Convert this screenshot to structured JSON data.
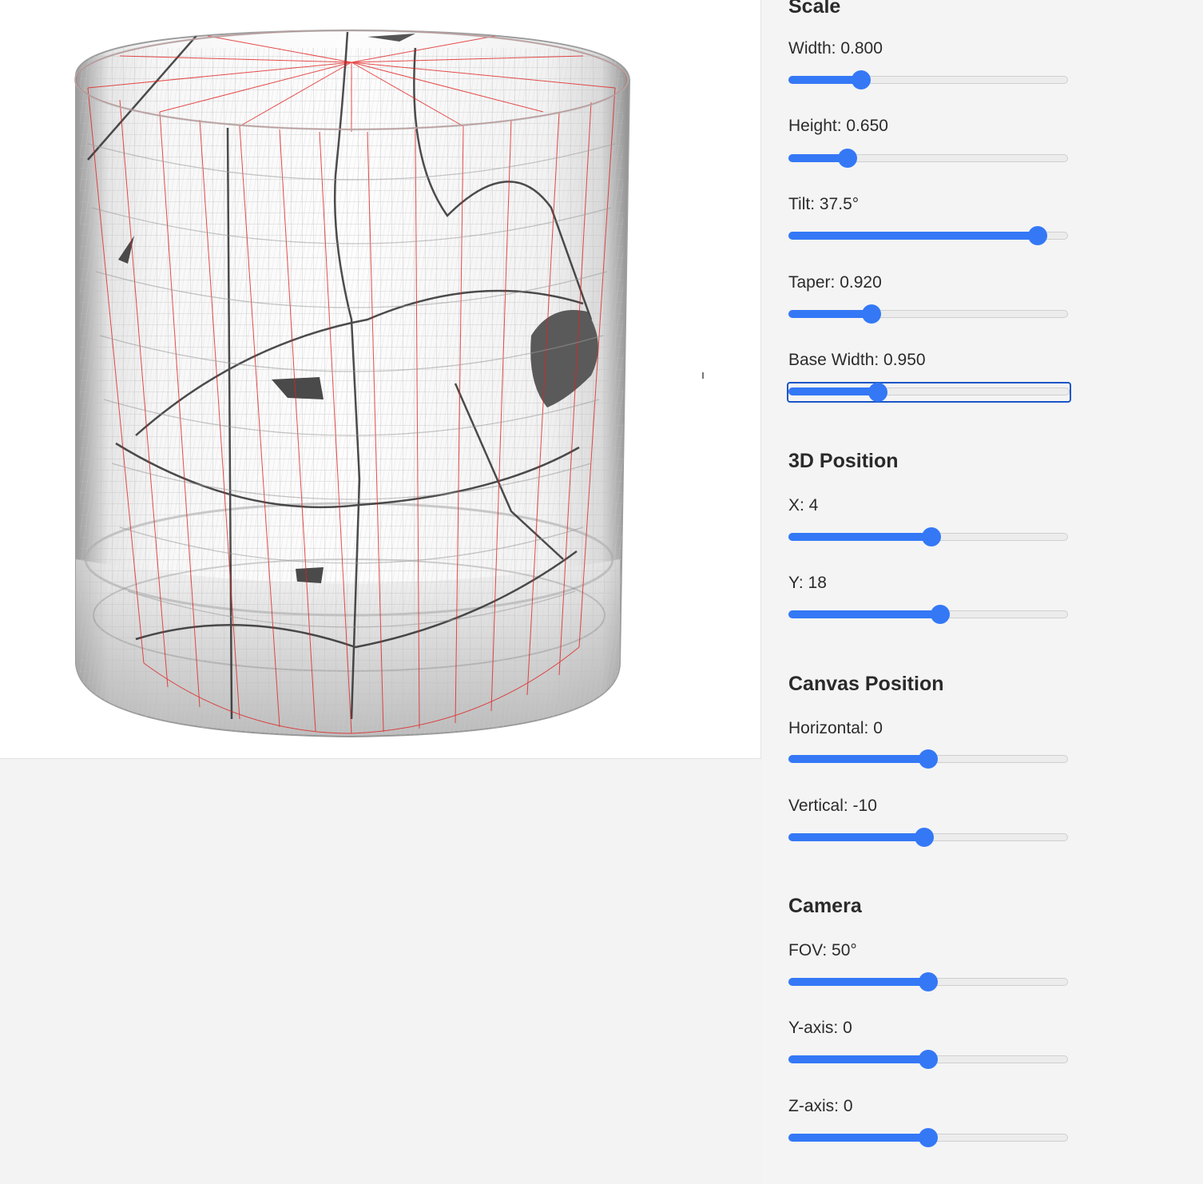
{
  "sections": [
    {
      "title": "Scale",
      "controls": [
        {
          "label": "Width: 0.800",
          "value_fraction": 0.26
        },
        {
          "label": "Height: 0.650",
          "value_fraction": 0.21
        },
        {
          "label": "Tilt: 37.5°",
          "value_fraction": 0.89
        },
        {
          "label": "Taper: 0.920",
          "value_fraction": 0.297
        },
        {
          "label": "Base Width: 0.950",
          "value_fraction": 0.318,
          "focused": true
        }
      ]
    },
    {
      "title": "3D Position",
      "controls": [
        {
          "label": "X: 4",
          "value_fraction": 0.51
        },
        {
          "label": "Y: 18",
          "value_fraction": 0.543
        }
      ]
    },
    {
      "title": "Canvas Position",
      "controls": [
        {
          "label": "Horizontal: 0",
          "value_fraction": 0.5
        },
        {
          "label": "Vertical: -10",
          "value_fraction": 0.486
        }
      ]
    },
    {
      "title": "Camera",
      "controls": [
        {
          "label": "FOV: 50°",
          "value_fraction": 0.5
        },
        {
          "label": "Y-axis: 0",
          "value_fraction": 0.5
        },
        {
          "label": "Z-axis: 0",
          "value_fraction": 0.5
        }
      ]
    }
  ],
  "colors": {
    "accent": "#3478f6",
    "focus_ring": "#1a56c8",
    "wireframe": "#e02020",
    "glass": "#c8c8c8"
  }
}
